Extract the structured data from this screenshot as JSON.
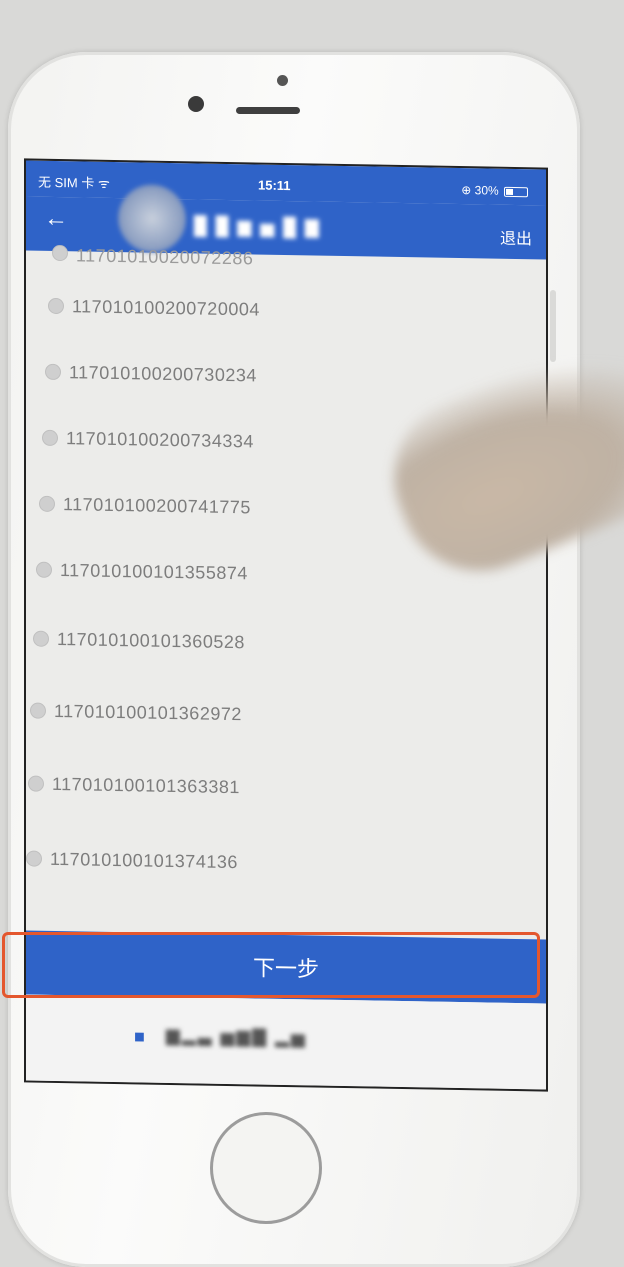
{
  "status_bar": {
    "carrier": "无 SIM 卡 ᯤ",
    "time": "15:11",
    "battery": "⊕ 30%"
  },
  "nav": {
    "back_icon": "arrow-left-icon",
    "title": "█ █ ▆ ▅ █ ▇",
    "logout": "退出"
  },
  "list": {
    "partial_item": "11701010020072286",
    "items": [
      "117010100200720004",
      "117010100200730234",
      "117010100200734334",
      "117010100200741775",
      "117010100101355874",
      "117010100101360528",
      "117010100101362972",
      "117010100101363381",
      "117010100101374136"
    ]
  },
  "next_button": {
    "label": "下一步"
  },
  "footer": {
    "icon": "building-icon",
    "text": "▆▂▃ ▅▆▇ ▂▅"
  },
  "colors": {
    "primary": "#2f63c8",
    "highlight": "#e4572e"
  }
}
